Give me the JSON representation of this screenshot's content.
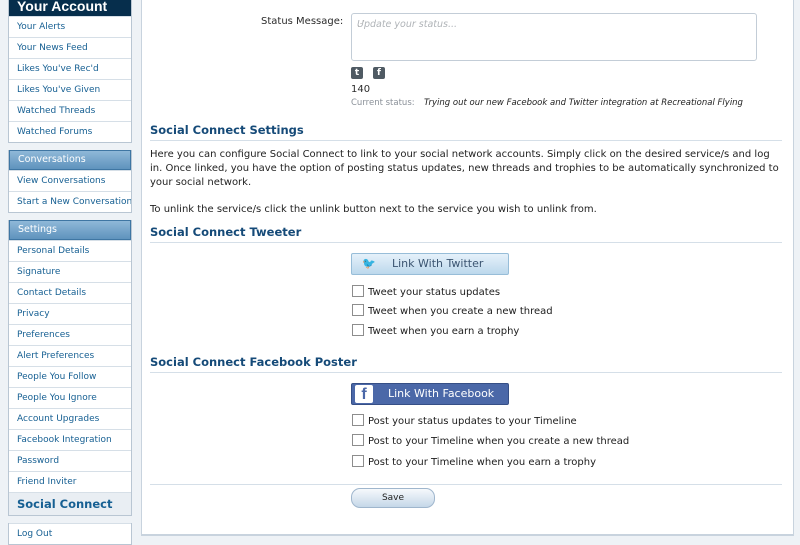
{
  "sidebar": {
    "account_title": "Your Account",
    "account_items": [
      "Your Alerts",
      "Your News Feed",
      "Likes You've Rec'd",
      "Likes You've Given",
      "Watched Threads",
      "Watched Forums"
    ],
    "conversations_header": "Conversations",
    "conversation_items": [
      "View Conversations",
      "Start a New Conversation"
    ],
    "settings_header": "Settings",
    "settings_items": [
      "Personal Details",
      "Signature",
      "Contact Details",
      "Privacy",
      "Preferences",
      "Alert Preferences",
      "People You Follow",
      "People You Ignore",
      "Account Upgrades",
      "Facebook Integration",
      "Password",
      "Friend Inviter",
      "Social Connect"
    ],
    "logout": "Log Out"
  },
  "status": {
    "label": "Status Message:",
    "placeholder": "Update your status...",
    "char_count": "140",
    "current_label": "Current status:",
    "current_value": "Trying out our new Facebook and Twitter integration at Recreational Flying"
  },
  "settings_section": {
    "title": "Social Connect Settings",
    "paragraph1": "Here you can configure Social Connect to link to your social network accounts. Simply click on the desired service/s and log in. Once linked, you have the option of posting status updates, new threads and trophies to be automatically synchronized to your social network.",
    "paragraph2": "To unlink the service/s click the unlink button next to the service you wish to unlink from."
  },
  "twitter_section": {
    "title": "Social Connect Tweeter",
    "button_label": "Link With Twitter",
    "options": [
      "Tweet your status updates",
      "Tweet when you create a new thread",
      "Tweet when you earn a trophy"
    ]
  },
  "facebook_section": {
    "title": "Social Connect Facebook Poster",
    "button_label": "Link With Facebook",
    "options": [
      "Post your status updates to your Timeline",
      "Post to your Timeline when you create a new thread",
      "Post to your Timeline when you earn a trophy"
    ]
  },
  "save_label": "Save",
  "icons": {
    "twitter": "twitter-icon",
    "facebook": "facebook-icon",
    "resize": "resize-grip-icon"
  },
  "colors": {
    "sidebar_title_bg": "#062e4c",
    "link": "#176093",
    "section_title": "#154a78",
    "facebook_blue": "#4b68a8"
  }
}
